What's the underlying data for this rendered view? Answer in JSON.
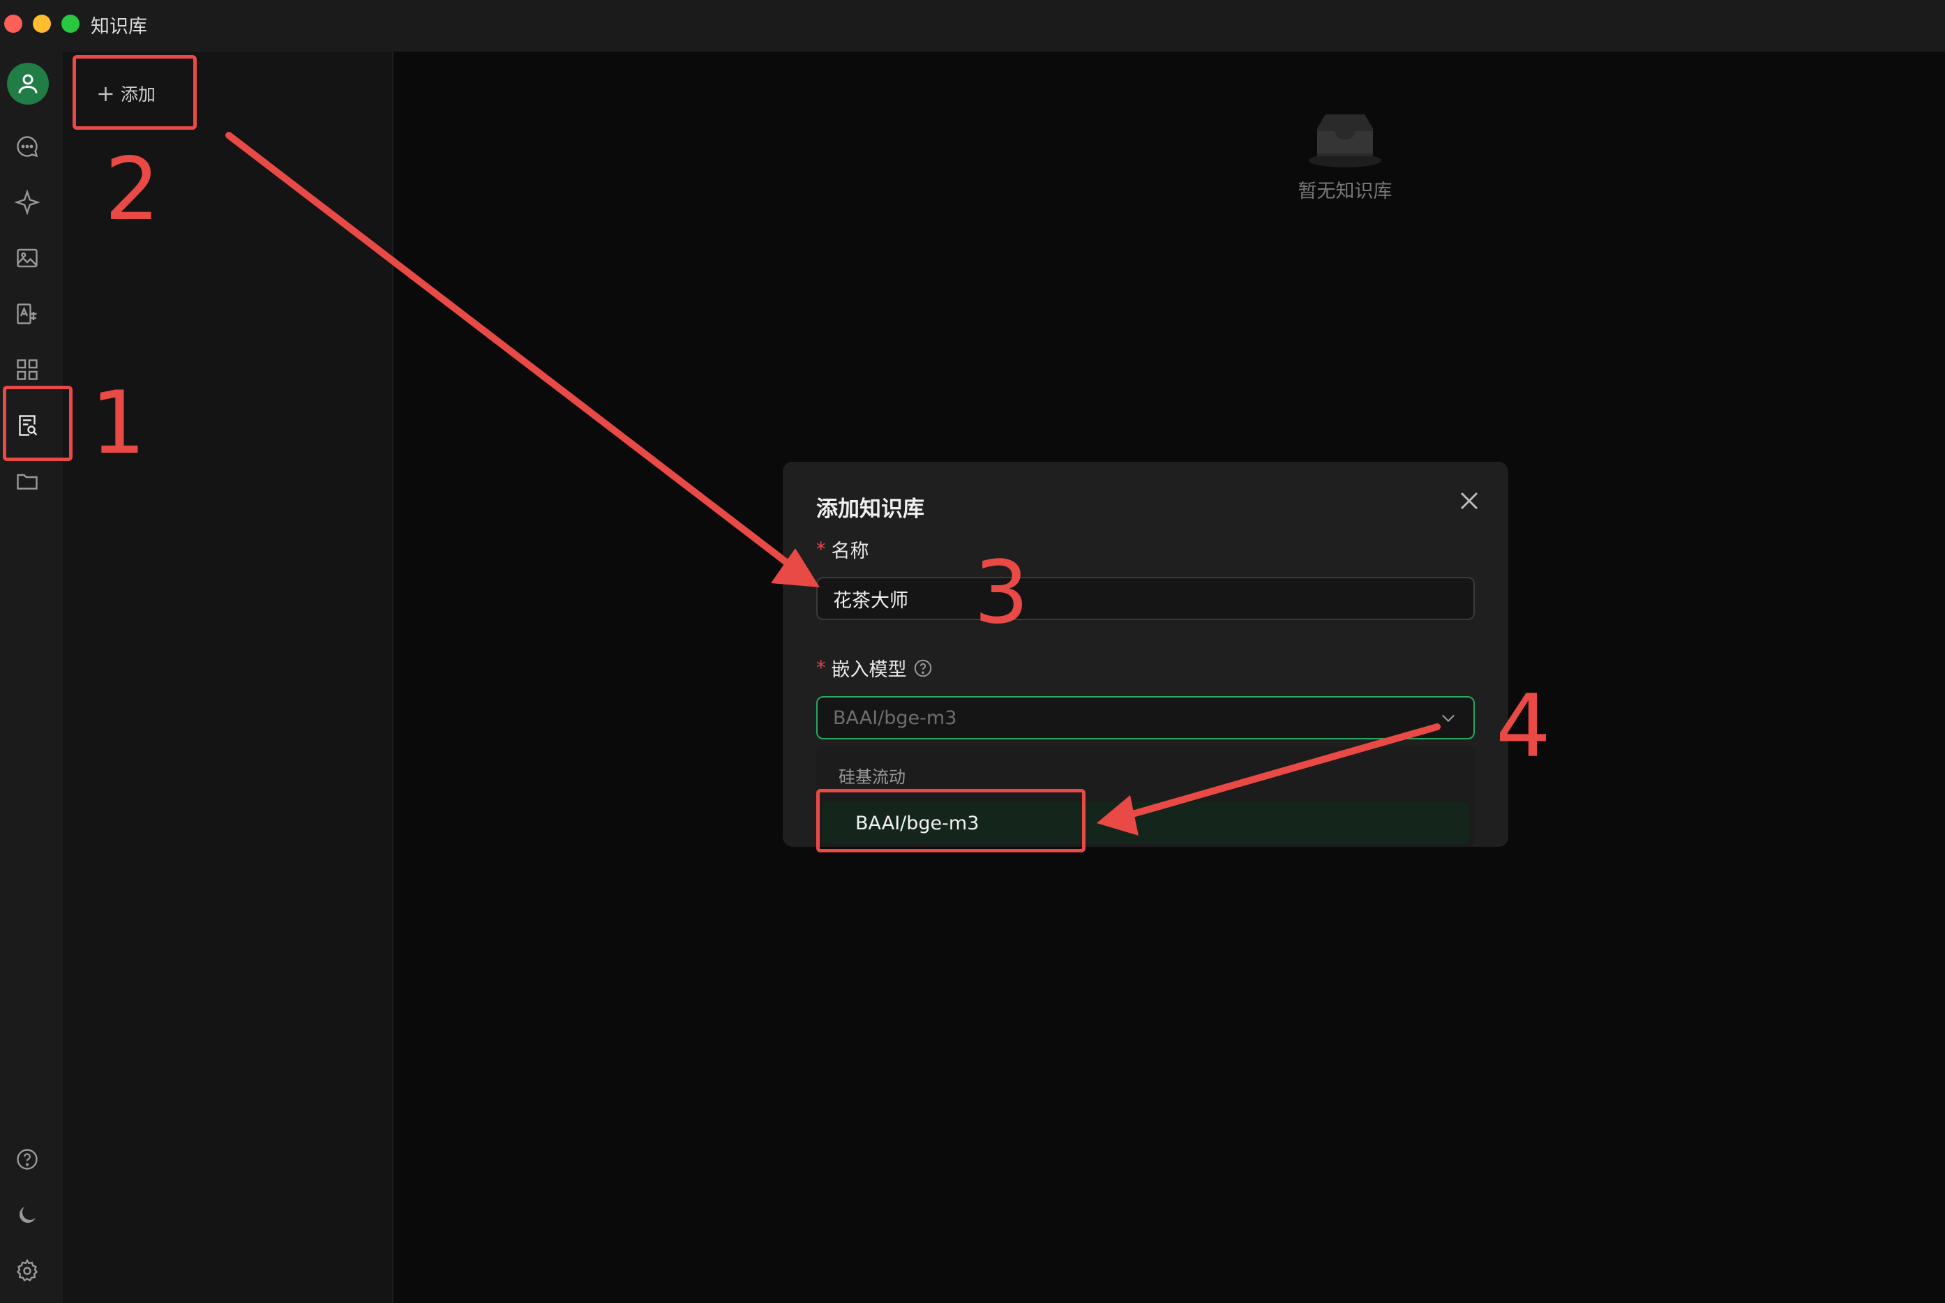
{
  "window": {
    "title": "知识库"
  },
  "sidebar": {
    "items": [
      {
        "name": "chat-icon"
      },
      {
        "name": "sparkle-icon"
      },
      {
        "name": "image-icon"
      },
      {
        "name": "translate-icon"
      },
      {
        "name": "apps-icon"
      },
      {
        "name": "knowledge-base-icon",
        "active": true
      },
      {
        "name": "folder-icon"
      }
    ],
    "bottom_items": [
      {
        "name": "help-icon"
      },
      {
        "name": "moon-icon"
      },
      {
        "name": "settings-icon"
      }
    ]
  },
  "list_panel": {
    "add_label": "添加"
  },
  "empty_state": {
    "label": "暂无知识库"
  },
  "dialog": {
    "title": "添加知识库",
    "name_field": {
      "label": "名称",
      "value": "花茶大师"
    },
    "model_field": {
      "label": "嵌入模型",
      "selected": "BAAI/bge-m3",
      "options_group": "硅基流动",
      "options": [
        "BAAI/bge-m3"
      ]
    }
  },
  "annotations": {
    "steps": [
      "1",
      "2",
      "3",
      "4"
    ],
    "color": "#ea4a46"
  },
  "colors": {
    "accent_green": "#2aa860",
    "avatar_green": "#1f7d45"
  }
}
